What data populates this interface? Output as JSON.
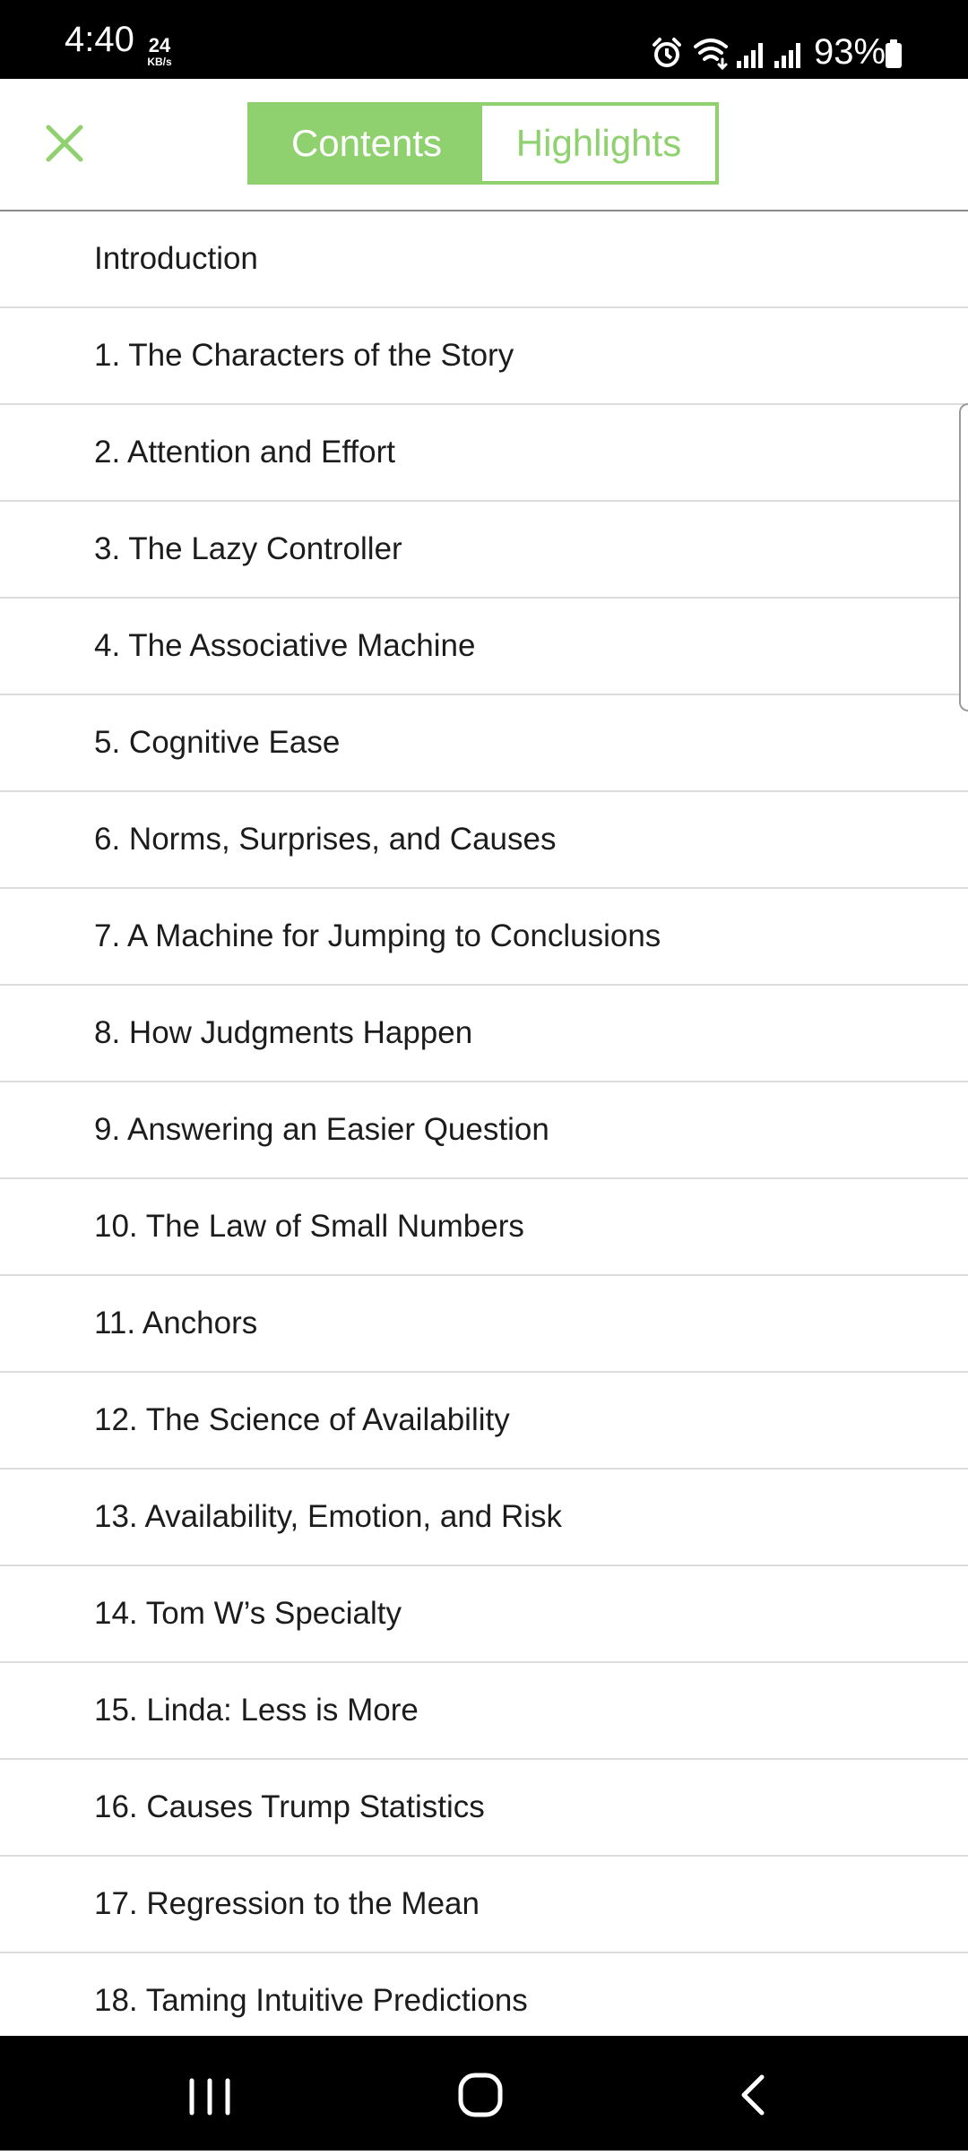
{
  "status_bar": {
    "time": "4:40",
    "speed_value": "24",
    "speed_unit": "KB/s",
    "battery_percent": "93%",
    "icons": [
      "alarm-icon",
      "wifi-icon",
      "signal-icon",
      "signal-icon",
      "battery-icon"
    ]
  },
  "header": {
    "close_icon": "close-icon",
    "tabs": [
      {
        "label": "Contents",
        "active": true
      },
      {
        "label": "Highlights",
        "active": false
      }
    ]
  },
  "toc": {
    "items": [
      "Introduction",
      "1. The Characters of the Story",
      "2. Attention and Effort",
      "3. The Lazy Controller",
      "4. The Associative Machine",
      "5. Cognitive Ease",
      "6. Norms, Surprises, and Causes",
      "7. A Machine for Jumping to Conclusions",
      "8. How Judgments Happen",
      "9. Answering an Easier Question",
      "10. The Law of Small Numbers",
      "11. Anchors",
      "12. The Science of Availability",
      "13. Availability, Emotion, and Risk",
      "14. Tom W’s Specialty",
      "15. Linda: Less is More",
      "16. Causes Trump Statistics",
      "17. Regression to the Mean",
      "18. Taming Intuitive Predictions"
    ]
  },
  "nav_bar": {
    "buttons": [
      "recent-apps-icon",
      "home-icon",
      "back-icon"
    ]
  },
  "colors": {
    "accent": "#8fd16f",
    "status_bar_bg": "#000000",
    "divider": "#dcdcdc"
  }
}
